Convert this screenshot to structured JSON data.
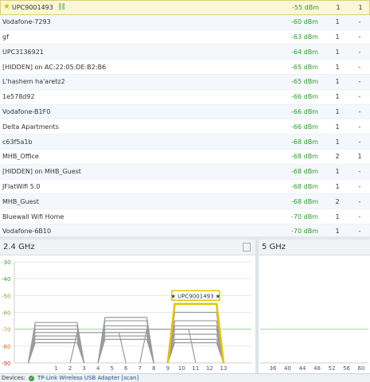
{
  "networks": [
    {
      "name": "UPC9001493",
      "signal": "-55 dBm",
      "channel": "1",
      "extra": "1",
      "selected": true
    },
    {
      "name": "Vodafone-7293",
      "signal": "-60 dBm",
      "channel": "1",
      "extra": "-"
    },
    {
      "name": "gf",
      "signal": "-63 dBm",
      "channel": "1",
      "extra": "-"
    },
    {
      "name": "UPC3136921",
      "signal": "-64 dBm",
      "channel": "1",
      "extra": "-"
    },
    {
      "name": "[HIDDEN] on AC:22:05:DE:B2:B6",
      "signal": "-65 dBm",
      "channel": "1",
      "extra": "-"
    },
    {
      "name": "L'hashem ha'aretz2",
      "signal": "-65 dBm",
      "channel": "1",
      "extra": "-"
    },
    {
      "name": "1e578d92",
      "signal": "-66 dBm",
      "channel": "1",
      "extra": "-"
    },
    {
      "name": "Vodafone-B1F0",
      "signal": "-66 dBm",
      "channel": "1",
      "extra": "-"
    },
    {
      "name": "Delta Apartments",
      "signal": "-66 dBm",
      "channel": "1",
      "extra": "-"
    },
    {
      "name": "c63f5a1b",
      "signal": "-68 dBm",
      "channel": "1",
      "extra": "-"
    },
    {
      "name": "MHB_Office",
      "signal": "-68 dBm",
      "channel": "2",
      "extra": "1"
    },
    {
      "name": "[HIDDEN] on MHB_Guest",
      "signal": "-68 dBm",
      "channel": "1",
      "extra": "-"
    },
    {
      "name": "JFlatWifi 5.0",
      "signal": "-68 dBm",
      "channel": "1",
      "extra": "-"
    },
    {
      "name": "MHB_Guest",
      "signal": "-68 dBm",
      "channel": "2",
      "extra": "-"
    },
    {
      "name": "Bluewall Wifi Home",
      "signal": "-70 dBm",
      "channel": "1",
      "extra": "-"
    },
    {
      "name": "Vodafone-6B10",
      "signal": "-70 dBm",
      "channel": "1",
      "extra": "-"
    }
  ],
  "icons": {
    "favorite": "star-icon",
    "connected": "link-icon",
    "copy": "copy-icon",
    "status": "check-icon"
  },
  "colors": {
    "selected_row": "#fbf7d4",
    "signal_text": "#2f9a2f",
    "highlight": "#e6c200",
    "trace": "#9a9a9a"
  },
  "panels": {
    "ghz24_title": "2.4 GHz",
    "ghz5_title": "5 GHz"
  },
  "chart_data": [
    {
      "type": "line",
      "title": "2.4 GHz",
      "y_ticks": [
        "-30",
        "-40",
        "-50",
        "-60",
        "-70",
        "-80",
        "-90"
      ],
      "ylim": [
        -90,
        -30
      ],
      "x_ticks": [
        "1",
        "2",
        "3",
        "4",
        "5",
        "6",
        "7",
        "8",
        "9",
        "10",
        "11",
        "12",
        "13"
      ],
      "xlim": [
        -2,
        15
      ],
      "annotation": "★ UPC9001493 ★",
      "highlight": {
        "name": "UPC9001493",
        "channel": 11,
        "level": -55
      },
      "series": [
        {
          "channel": 11,
          "level": -60
        },
        {
          "channel": 11,
          "level": -65
        },
        {
          "channel": 11,
          "level": -68
        },
        {
          "channel": 11,
          "level": -70
        },
        {
          "channel": 11,
          "level": -73
        },
        {
          "channel": 11,
          "level": -76
        },
        {
          "channel": 11,
          "level": -78
        },
        {
          "channel": 6,
          "level": -63
        },
        {
          "channel": 6,
          "level": -65
        },
        {
          "channel": 6,
          "level": -68
        },
        {
          "channel": 6,
          "level": -70
        },
        {
          "channel": 6,
          "level": -72
        },
        {
          "channel": 6,
          "level": -74
        },
        {
          "channel": 6,
          "level": -76
        },
        {
          "channel": 1,
          "level": -66
        },
        {
          "channel": 1,
          "level": -68
        },
        {
          "channel": 1,
          "level": -70
        },
        {
          "channel": 1,
          "level": -72
        },
        {
          "channel": 1,
          "level": -74
        },
        {
          "channel": 1,
          "level": -76
        },
        {
          "channel": 1,
          "level": -78
        },
        {
          "channel": 9,
          "level": -70
        },
        {
          "channel": 4,
          "level": -72
        }
      ]
    },
    {
      "type": "line",
      "title": "5 GHz",
      "x_ticks": [
        "36",
        "40",
        "44",
        "48",
        "52",
        "56",
        "60"
      ],
      "series": []
    }
  ],
  "status_bar": {
    "prefix": "Devices:",
    "device": "TP-Link Wireless USB Adapter [scan]"
  }
}
